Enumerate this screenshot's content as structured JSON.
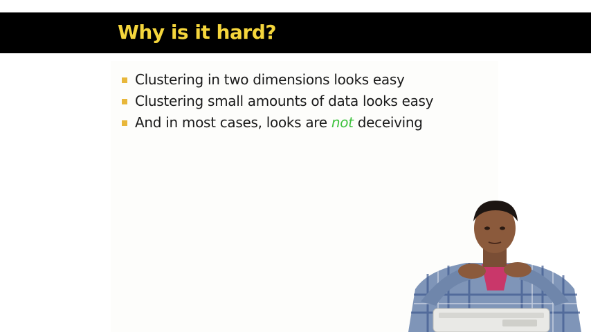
{
  "slide": {
    "title": "Why is it hard?",
    "bullets": [
      {
        "before": "Clustering in two dimensions looks easy",
        "emph": "",
        "after": ""
      },
      {
        "before": "Clustering small amounts of data looks easy",
        "emph": "",
        "after": ""
      },
      {
        "before": "And in most cases, looks are ",
        "emph": "not",
        "after": " deceiving"
      }
    ]
  },
  "colors": {
    "title_bar_bg": "#000000",
    "title_text": "#f5d63c",
    "bullet_marker": "#e8b73a",
    "emphasis_text": "#3ec23e",
    "body_text": "#1a1a1a"
  },
  "icons": {
    "bullet": "square-bullet-icon"
  }
}
